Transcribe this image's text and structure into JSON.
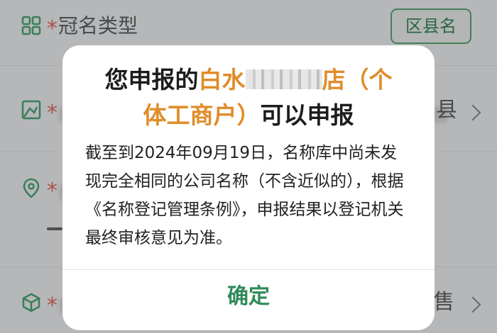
{
  "form": {
    "row1_label": "冠名类型",
    "required_mark": "*",
    "region_button": "区县名",
    "row2_tail": "县",
    "row4_tail": "售"
  },
  "dialog": {
    "title_prefix": "您申报的",
    "title_name_start": "白水",
    "title_name_end": "店（个",
    "title_line2_highlight": "体工商户）",
    "title_line2_rest": "可以申报",
    "message": "截至到2024年09月19日，名称库中尚未发现完全相同的公司名称（不含近似的），根据《名称登记管理条例》，申报结果以登记机关最终审核意见为准。",
    "confirm_label": "确定"
  },
  "colors": {
    "accent_green": "#2f8a5a",
    "highlight_orange": "#e08d2a"
  }
}
